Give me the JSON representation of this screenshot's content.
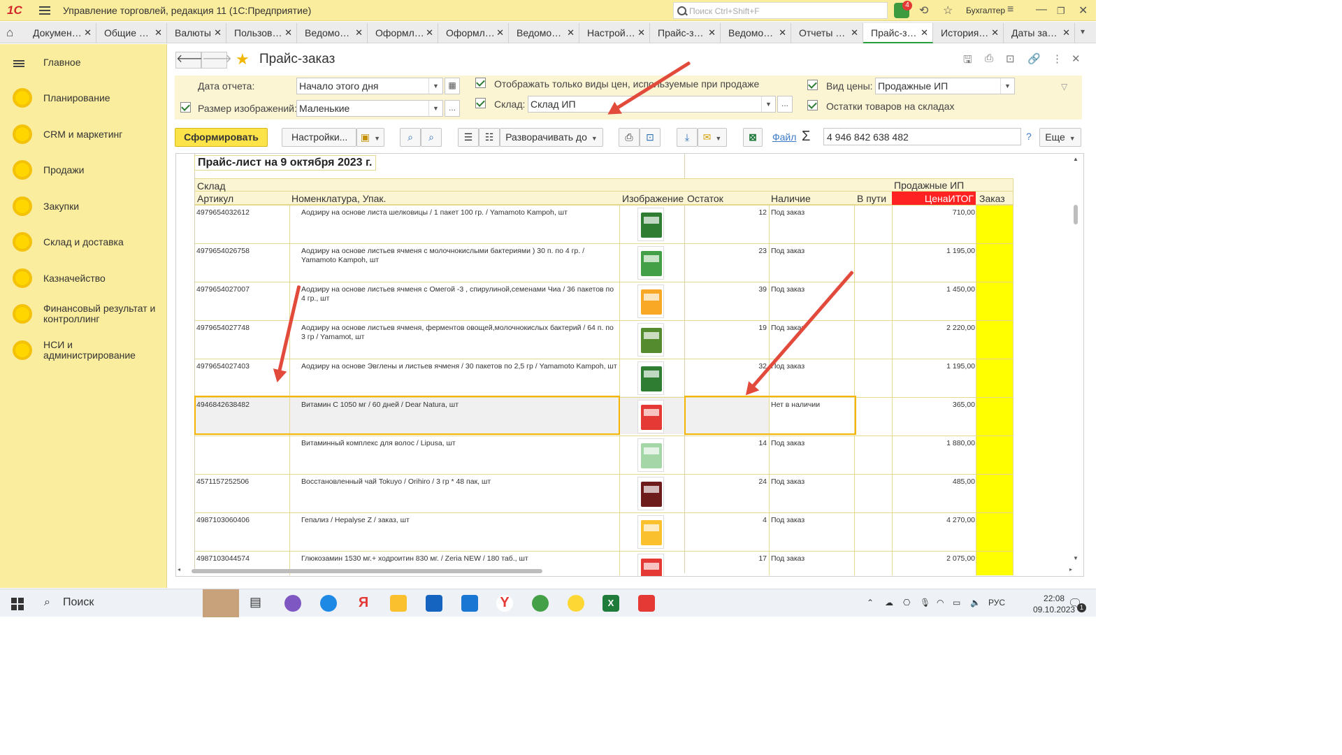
{
  "titlebar": {
    "logo": "1С",
    "title": "Управление торговлей, редакция 11  (1С:Предприятие)",
    "search_placeholder": "Поиск Ctrl+Shift+F",
    "notifications": "4",
    "user": "Бухгалтер"
  },
  "tabs": [
    {
      "label": "Докумен…"
    },
    {
      "label": "Общие …"
    },
    {
      "label": "Валюты"
    },
    {
      "label": "Пользов…"
    },
    {
      "label": "Ведомо…"
    },
    {
      "label": "Оформл…"
    },
    {
      "label": "Оформл…"
    },
    {
      "label": "Ведомо…"
    },
    {
      "label": "Настрой…"
    },
    {
      "label": "Прайс-з…"
    },
    {
      "label": "Ведомо…"
    },
    {
      "label": "Отчеты …"
    },
    {
      "label": "Прайс-з…"
    },
    {
      "label": "История…"
    },
    {
      "label": "Даты за…"
    }
  ],
  "tab_close": "✕",
  "sidebar": {
    "main": "Главное",
    "items": [
      {
        "label": "Планирование"
      },
      {
        "label": "CRM и маркетинг"
      },
      {
        "label": "Продажи"
      },
      {
        "label": "Закупки"
      },
      {
        "label": "Склад и доставка"
      },
      {
        "label": "Казначейство"
      },
      {
        "label": "Финансовый результат и контроллинг"
      },
      {
        "label": "НСИ и администрирование"
      }
    ]
  },
  "page": {
    "title": "Прайс-заказ",
    "nav_back": "🡐",
    "nav_forward": "🡒"
  },
  "params": {
    "date_label": "Дата отчета:",
    "date_value": "Начало этого дня",
    "image_size_label": "Размер изображений:",
    "image_size_value": "Маленькие",
    "only_sale_prices": "Отображать только виды цен, используемые при продаже",
    "warehouse_label": "Склад:",
    "warehouse_value": "Склад ИП",
    "price_type_label": "Вид цены:",
    "price_type_value": "Продажные ИП",
    "stock_on_hand": "Остатки товаров на складах",
    "ellipsis": "..."
  },
  "toolbar": {
    "generate": "Сформировать",
    "settings": "Настройки...",
    "expand_to": "Разворачивать до",
    "file_link": "Файл",
    "sigma": "Σ",
    "sum_value": "4 946 842 638 482",
    "help": "?",
    "more": "Еще"
  },
  "report": {
    "title": "Прайс-лист на 9 октября 2023 г.",
    "group_header": "Склад",
    "price_group": "Продажные ИП",
    "columns": {
      "article": "Артикул",
      "name": "Номенклатура, Упак.",
      "image": "Изображение",
      "remainder": "Остаток",
      "availability": "Наличие",
      "in_transit": "В пути",
      "price": "ЦенаИТОГ",
      "order": "Заказ"
    },
    "rows": [
      {
        "article": "4979654032612",
        "name": "Аодзиру на основе листа шелковицы / 1 пакет 100 гр. / Yamamoto Kampoh, шт",
        "remainder": "12",
        "availability": "Под заказ",
        "price": "710,00",
        "img_color": "#2e7d32"
      },
      {
        "article": "4979654026758",
        "name": "Аодзиру на основе листьев ячменя с молочнокислыми бактериями )  30 п. по 4 гр. / Yamamoto Kampoh, шт",
        "remainder": "23",
        "availability": "Под заказ",
        "price": "1 195,00",
        "img_color": "#43a047"
      },
      {
        "article": "4979654027007",
        "name": "Аодзиру на основе листьев ячменя с Омегой -3 , спирулиной,семенами Чиа /  36 пакетов по 4 гр., шт",
        "remainder": "39",
        "availability": "Под заказ",
        "price": "1 450,00",
        "img_color": "#f9a825"
      },
      {
        "article": "4979654027748",
        "name": "Аодзиру на основе листьев ячменя, ферментов овощей,молочнокислых бактерий / 64 п. по 3 гр /  Yamamot, шт",
        "remainder": "19",
        "availability": "Под заказ",
        "price": "2 220,00",
        "img_color": "#558b2f"
      },
      {
        "article": "4979654027403",
        "name": "Аодзиру на основе Эвглены и листьев ячменя / 30 пакетов по 2,5 гр / Yamamoto Kampoh, шт",
        "remainder": "32",
        "availability": "Под заказ",
        "price": "1 195,00",
        "img_color": "#2e7d32"
      },
      {
        "article": "4946842638482",
        "name": "Витамин С  1050 мг / 60 дней / Dear Natura, шт",
        "remainder": "",
        "availability": "Нет в наличии",
        "price": "365,00",
        "img_color": "#e53935"
      },
      {
        "article": "",
        "name": "Витаминный комплекс для волос / Lipusa, шт",
        "remainder": "14",
        "availability": "Под заказ",
        "price": "1 880,00",
        "img_color": "#a5d6a7"
      },
      {
        "article": "4571157252506",
        "name": "Восстановленный чай Tokuyo / Orihiro / 3 гр * 48 пак, шт",
        "remainder": "24",
        "availability": "Под заказ",
        "price": "485,00",
        "img_color": "#6d1b1b"
      },
      {
        "article": "4987103060406",
        "name": "Гепализ / Hepalyse Z / заказ, шт",
        "remainder": "4",
        "availability": "Под заказ",
        "price": "4 270,00",
        "img_color": "#fbc02d"
      },
      {
        "article": "4987103044574",
        "name": "Глюкозамин 1530 мг.+ ходроитин 830 мг. / Zeria NEW / 180 таб., шт",
        "remainder": "17",
        "availability": "Под заказ",
        "price": "2 075,00",
        "img_color": "#e53935"
      }
    ]
  },
  "taskbar": {
    "search": "Поиск",
    "lang": "РУС",
    "time": "22:08",
    "date": "09.10.2023",
    "notif": "1"
  },
  "colors": {
    "accent_yellow": "#fbed9e",
    "button_yellow": "#fde34a",
    "price_header_red": "#ff2222",
    "order_col_yellow": "#ffff00",
    "annotation_arrow": "#e24a3b"
  }
}
